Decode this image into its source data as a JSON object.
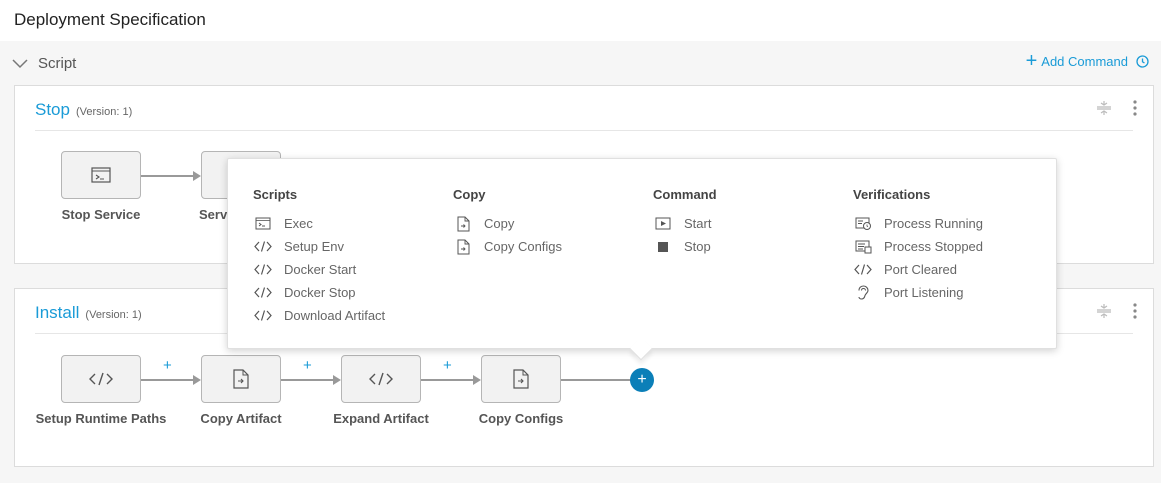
{
  "page": {
    "title": "Deployment Specification"
  },
  "section": {
    "title": "Script",
    "add_command": "Add Command"
  },
  "stop_card": {
    "title": "Stop",
    "version": "(Version: 1)",
    "nodes": [
      {
        "label": "Stop Service",
        "icon": "terminal-icon"
      },
      {
        "label": "Servic",
        "icon": "file-copy-icon"
      }
    ]
  },
  "install_card": {
    "title": "Install",
    "version": "(Version: 1)",
    "nodes": [
      {
        "label": "Setup Runtime Paths",
        "icon": "code-icon"
      },
      {
        "label": "Copy Artifact",
        "icon": "file-copy-icon"
      },
      {
        "label": "Expand Artifact",
        "icon": "code-icon"
      },
      {
        "label": "Copy Configs",
        "icon": "file-copy-icon"
      }
    ],
    "plus": "+",
    "add_node": "+"
  },
  "popup": {
    "columns": [
      {
        "title": "Scripts",
        "items": [
          {
            "label": "Exec",
            "icon": "terminal-icon"
          },
          {
            "label": "Setup Env",
            "icon": "code-icon"
          },
          {
            "label": "Docker Start",
            "icon": "code-icon"
          },
          {
            "label": "Docker Stop",
            "icon": "code-icon"
          },
          {
            "label": "Download Artifact",
            "icon": "code-icon"
          }
        ]
      },
      {
        "title": "Copy",
        "items": [
          {
            "label": "Copy",
            "icon": "file-copy-icon"
          },
          {
            "label": "Copy Configs",
            "icon": "file-copy-icon"
          }
        ]
      },
      {
        "title": "Command",
        "items": [
          {
            "label": "Start",
            "icon": "play-icon"
          },
          {
            "label": "Stop",
            "icon": "stop-icon"
          }
        ]
      },
      {
        "title": "Verifications",
        "items": [
          {
            "label": "Process Running",
            "icon": "process-running-icon"
          },
          {
            "label": "Process Stopped",
            "icon": "process-stopped-icon"
          },
          {
            "label": "Port Cleared",
            "icon": "code-icon"
          },
          {
            "label": "Port Listening",
            "icon": "ear-icon"
          }
        ]
      }
    ]
  },
  "colors": {
    "accent": "#1a9bd7",
    "add_node": "#0b7fb8"
  }
}
